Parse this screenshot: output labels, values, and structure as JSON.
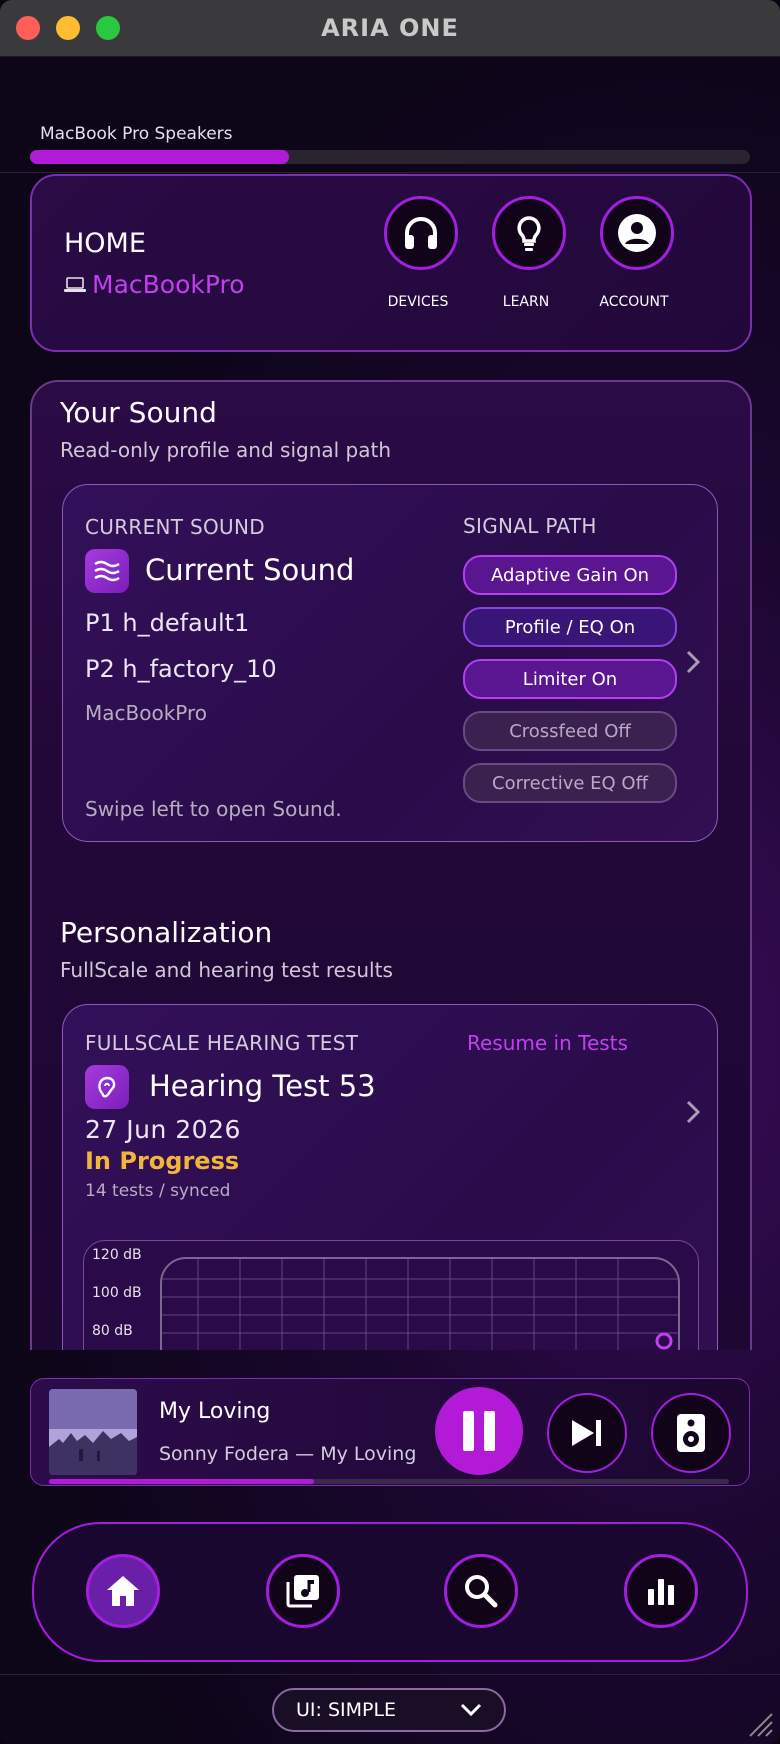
{
  "window": {
    "title": "ARIA ONE"
  },
  "output": {
    "device_name": "MacBook Pro Speakers",
    "level": 0.36
  },
  "home": {
    "title": "HOME",
    "device": "MacBookPro",
    "buttons": [
      {
        "label": "DEVICES",
        "icon": "headphones-icon"
      },
      {
        "label": "LEARN",
        "icon": "lightbulb-icon"
      },
      {
        "label": "ACCOUNT",
        "icon": "account-icon"
      }
    ]
  },
  "your_sound": {
    "title": "Your Sound",
    "subtitle": "Read-only profile and signal path",
    "card": {
      "caption": "CURRENT SOUND",
      "name": "Current Sound",
      "p1": "P1 h_default1",
      "p2": "P2 h_factory_10",
      "device": "MacBookPro",
      "hint": "Swipe left to open Sound.",
      "signal_path_caption": "SIGNAL PATH",
      "signal_path": [
        {
          "label": "Adaptive Gain On",
          "state": "on"
        },
        {
          "label": "Profile / EQ On",
          "state": "on"
        },
        {
          "label": "Limiter On",
          "state": "on"
        },
        {
          "label": "Crossfeed Off",
          "state": "off"
        },
        {
          "label": "Corrective EQ Off",
          "state": "off"
        }
      ]
    }
  },
  "personalization": {
    "title": "Personalization",
    "subtitle": "FullScale and hearing test results",
    "card": {
      "caption": "FULLSCALE HEARING TEST",
      "resume": "Resume in Tests",
      "name": "Hearing Test 53",
      "date": "27 Jun 2026",
      "status": "In Progress",
      "meta": "14 tests / synced",
      "db_labels": [
        "120 dB",
        "100 dB",
        "80 dB"
      ]
    }
  },
  "player": {
    "title": "My Loving",
    "artist_album": "Sonny Fodera — My Loving",
    "progress": 0.39
  },
  "nav": [
    {
      "name": "home",
      "icon": "home-icon",
      "active": true
    },
    {
      "name": "library",
      "icon": "music-library-icon",
      "active": false
    },
    {
      "name": "search",
      "icon": "search-icon",
      "active": false
    },
    {
      "name": "stats",
      "icon": "bar-chart-icon",
      "active": false
    }
  ],
  "ui_mode": {
    "value": "UI: SIMPLE"
  },
  "colors": {
    "accent": "#b31ad8",
    "status_in_progress": "#f2b53a",
    "link": "#c23ff0"
  }
}
